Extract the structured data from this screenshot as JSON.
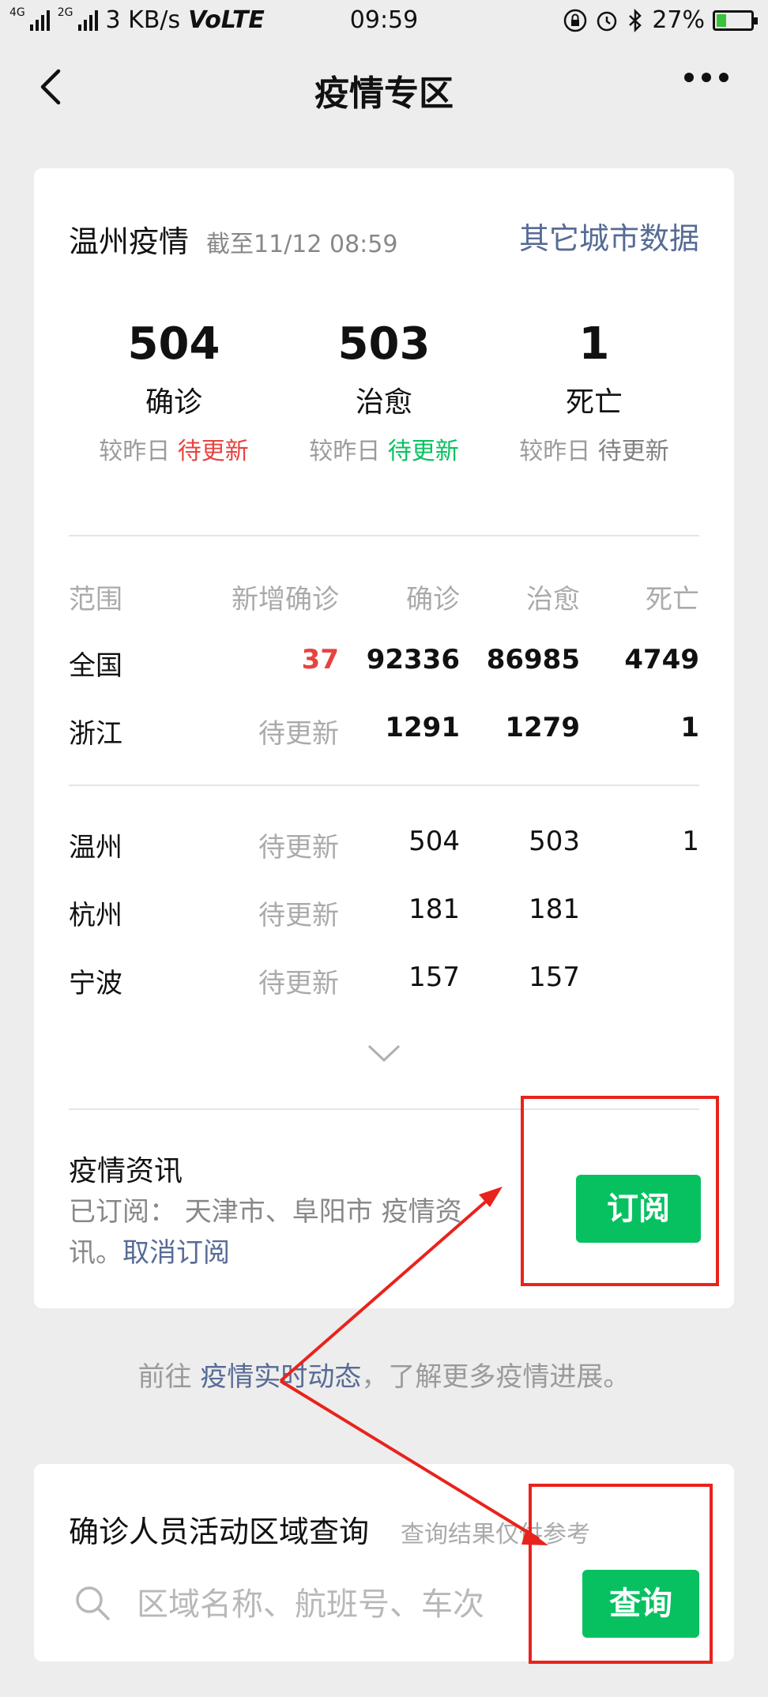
{
  "status_bar": {
    "network_left": "4G",
    "network_right": "2G",
    "speed": "3 KB/s",
    "volte": "VoLTE",
    "time": "09:59",
    "battery": "27%",
    "battery_level": 0.27
  },
  "nav": {
    "title": "疫情专区"
  },
  "local": {
    "city_title": "温州疫情",
    "as_of": "截至11/12 08:59",
    "other_cities_link": "其它城市数据",
    "stats": [
      {
        "value": "504",
        "label": "确诊",
        "compare_prefix": "较昨日",
        "compare_value": "待更新"
      },
      {
        "value": "503",
        "label": "治愈",
        "compare_prefix": "较昨日",
        "compare_value": "待更新"
      },
      {
        "value": "1",
        "label": "死亡",
        "compare_prefix": "较昨日",
        "compare_value": "待更新"
      }
    ]
  },
  "table": {
    "headers": [
      "范围",
      "新增确诊",
      "确诊",
      "治愈",
      "死亡"
    ],
    "rows": [
      [
        "全国",
        "37",
        "92336",
        "86985",
        "4749"
      ],
      [
        "浙江",
        "待更新",
        "1291",
        "1279",
        "1"
      ],
      [
        "温州",
        "待更新",
        "504",
        "503",
        "1"
      ],
      [
        "杭州",
        "待更新",
        "181",
        "181",
        ""
      ],
      [
        "宁波",
        "待更新",
        "157",
        "157",
        ""
      ]
    ]
  },
  "subscription": {
    "title": "疫情资讯",
    "desc": "已订阅： 天津市、阜阳市 疫情资讯。",
    "cancel_link": "取消订阅",
    "button": "订阅"
  },
  "hint": {
    "prefix": "前往 ",
    "link": "疫情实时动态",
    "suffix": "，了解更多疫情进展。"
  },
  "query": {
    "title": "确诊人员活动区域查询",
    "note": "查询结果仅供参考",
    "placeholder": "区域名称、航班号、车次",
    "button": "查询"
  },
  "colors": {
    "accent_green": "#07c160",
    "accent_red": "#e64340",
    "link_blue": "#576b95",
    "annotation_red": "#e8231c"
  }
}
